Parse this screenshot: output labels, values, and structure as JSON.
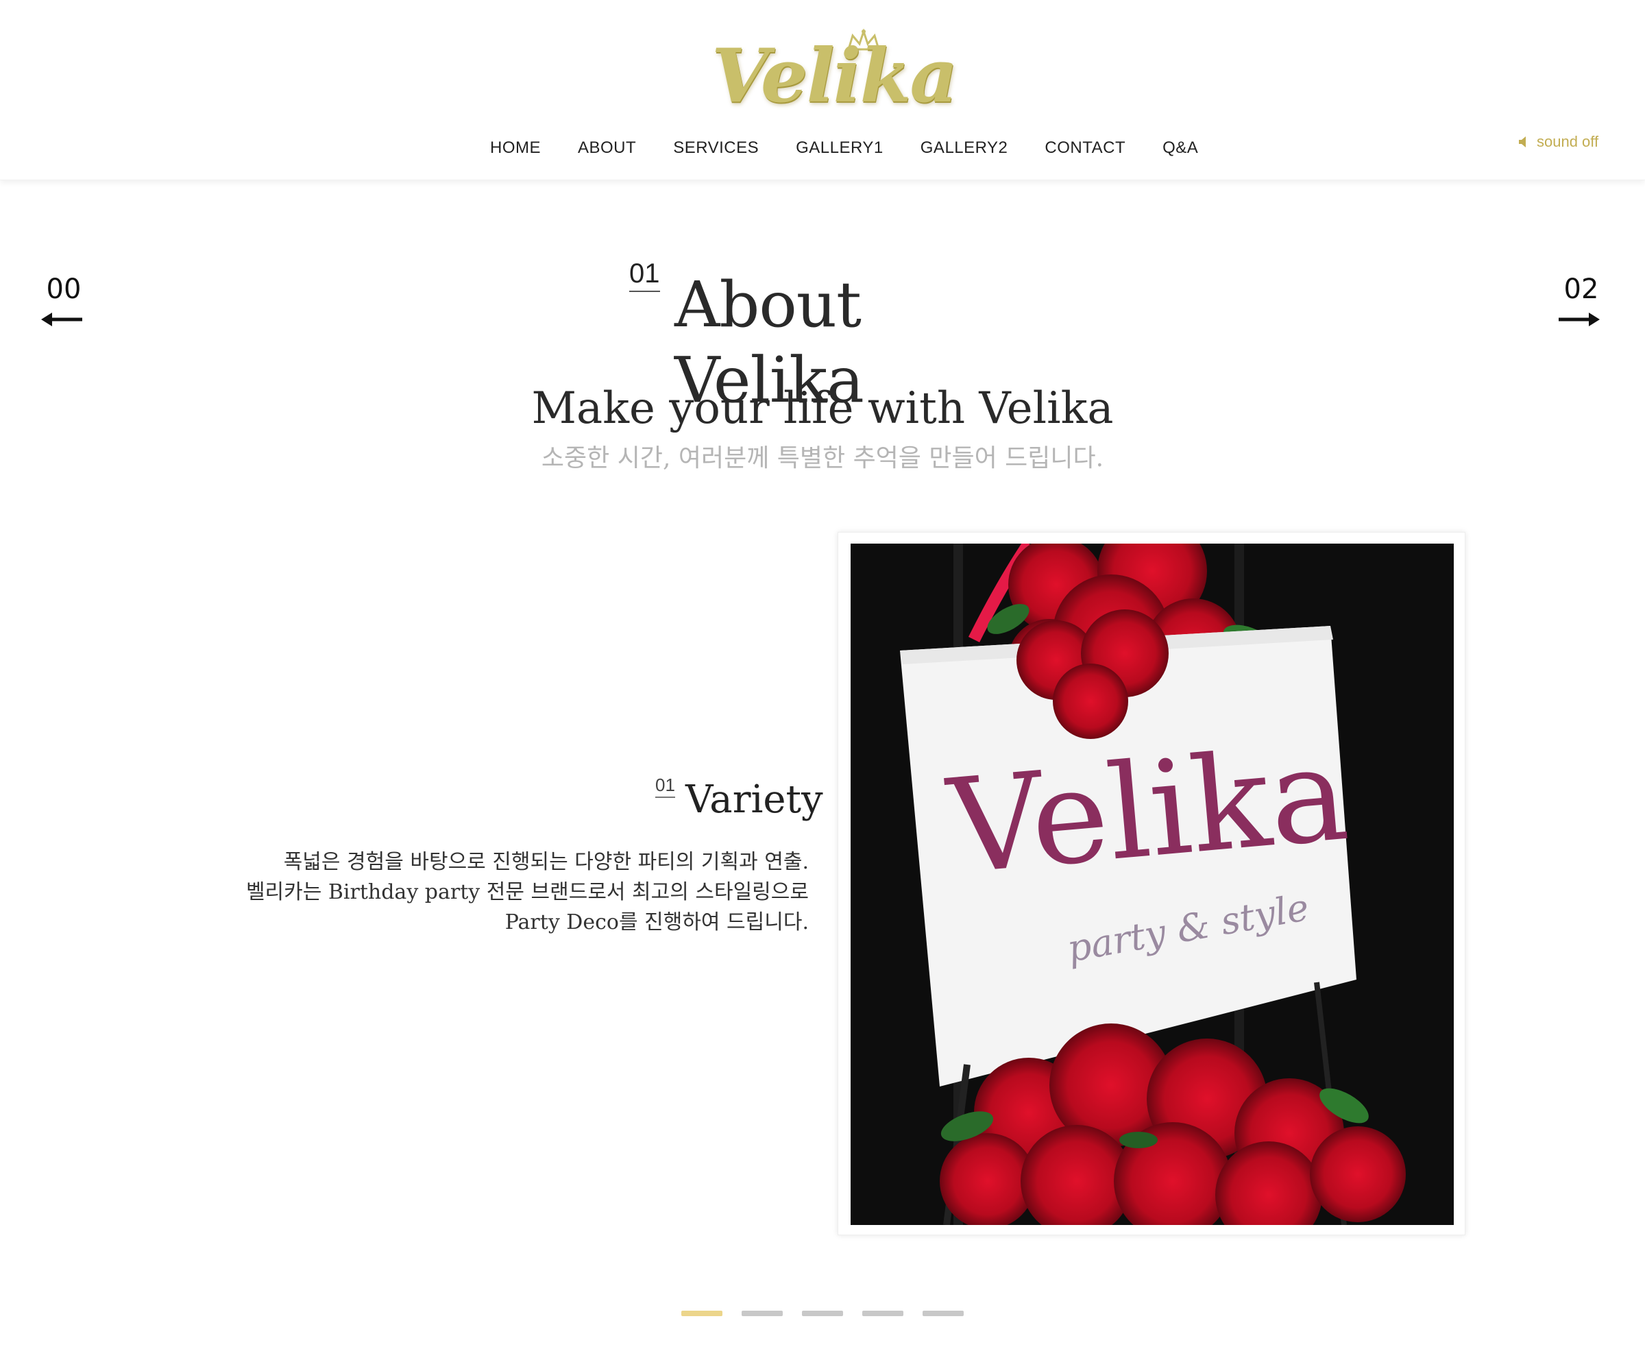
{
  "brand": {
    "logo_text": "Velika",
    "logo_color": "#c9bf6a"
  },
  "nav": {
    "items": [
      {
        "label": "HOME"
      },
      {
        "label": "ABOUT"
      },
      {
        "label": "SERVICES"
      },
      {
        "label": "GALLERY1"
      },
      {
        "label": "GALLERY2"
      },
      {
        "label": "CONTACT"
      },
      {
        "label": "Q&A"
      }
    ]
  },
  "sound": {
    "label": "sound off",
    "icon": "speaker-icon",
    "color": "#c2ad52"
  },
  "pager": {
    "prev_num": "00",
    "next_num": "02",
    "prev_icon": "arrow-left-icon",
    "next_icon": "arrow-right-icon"
  },
  "section": {
    "num": "01",
    "title": "About Velika",
    "headline": "Make your life with Velika",
    "subline": "소중한 시간, 여러분께 특별한 추억을 만들어 드립니다."
  },
  "feature": {
    "num": "01",
    "title": "Variety",
    "lines": [
      "폭넓은 경험을 바탕으로 진행되는 다양한 파티의 기획과 연출.",
      "벨리카는 Birthday party 전문 브랜드로서 최고의 스타일링으로",
      "Party Deco를 진행하여 드립니다."
    ]
  },
  "photo": {
    "sign_text": "Velika",
    "sign_subtext": "party & style"
  },
  "slider": {
    "count": 5,
    "active_index": 0,
    "active_color": "#ecd58b",
    "inactive_color": "#c8c8c8"
  }
}
